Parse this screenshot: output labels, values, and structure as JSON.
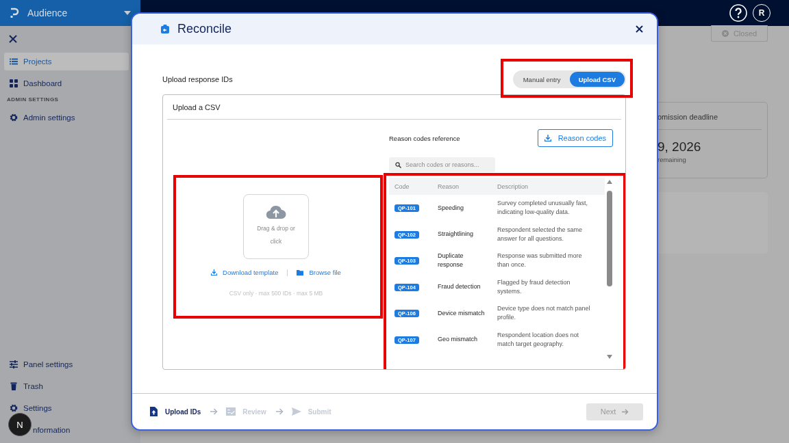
{
  "sidebar": {
    "brand": "Audience",
    "items": [
      {
        "label": "Projects",
        "selected": true
      },
      {
        "label": "Dashboard",
        "selected": false
      }
    ],
    "section": "ADMIN SETTINGS",
    "admin_items": [
      {
        "label": "Admin settings",
        "selected": false
      }
    ],
    "bottom_items": [
      {
        "label": "Panel settings",
        "selected": false
      },
      {
        "label": "Trash",
        "selected": false
      },
      {
        "label": "Settings",
        "selected": false
      },
      {
        "label": "nformation",
        "selected": false
      }
    ]
  },
  "topbar": {
    "avatar": "R"
  },
  "background": {
    "status_button": "Closed",
    "deadline_card": {
      "title": "omission deadline",
      "date": "9, 2026",
      "note": "remaining"
    }
  },
  "dev_badge": "N",
  "modal": {
    "title": "Reconcile",
    "section_label": "Upload response IDs",
    "mode_toggle": {
      "highlighted": true,
      "options": [
        {
          "label": "Manual entry",
          "selected": false
        },
        {
          "label": "Upload CSV",
          "selected": true
        }
      ]
    },
    "card_title": "Upload a CSV",
    "upload": {
      "highlighted": true,
      "dropzone_text": "Drag & drop or click",
      "download_link": "Download template",
      "browse_link": "Browse file",
      "hint": "CSV only · max 500 IDs · max 5 MB"
    },
    "reference": {
      "title": "Reason codes reference",
      "button": "Reason codes",
      "search": {
        "placeholder": "Search codes or reasons..."
      },
      "table": {
        "highlighted": true,
        "columns": [
          "Code",
          "Reason",
          "Description"
        ],
        "rows": [
          {
            "code": "QP-101",
            "reason": "Speeding",
            "description": "Survey completed unusually fast, indicating low-quality data."
          },
          {
            "code": "QP-102",
            "reason": "Straightlining",
            "description": "Respondent selected the same answer for all questions."
          },
          {
            "code": "QP-103",
            "reason": "Duplicate response",
            "description": "Response was submitted more than once."
          },
          {
            "code": "QP-104",
            "reason": "Fraud detection",
            "description": "Flagged by fraud detection systems."
          },
          {
            "code": "QP-106",
            "reason": "Device mismatch",
            "description": "Device type does not match panel profile."
          },
          {
            "code": "QP-107",
            "reason": "Geo mismatch",
            "description": "Respondent location does not match target geography."
          }
        ]
      }
    },
    "steps": [
      {
        "label": "Upload IDs",
        "active": true
      },
      {
        "label": "Review",
        "active": false
      },
      {
        "label": "Submit",
        "active": false
      }
    ],
    "next": {
      "label": "Next",
      "disabled": true
    }
  }
}
